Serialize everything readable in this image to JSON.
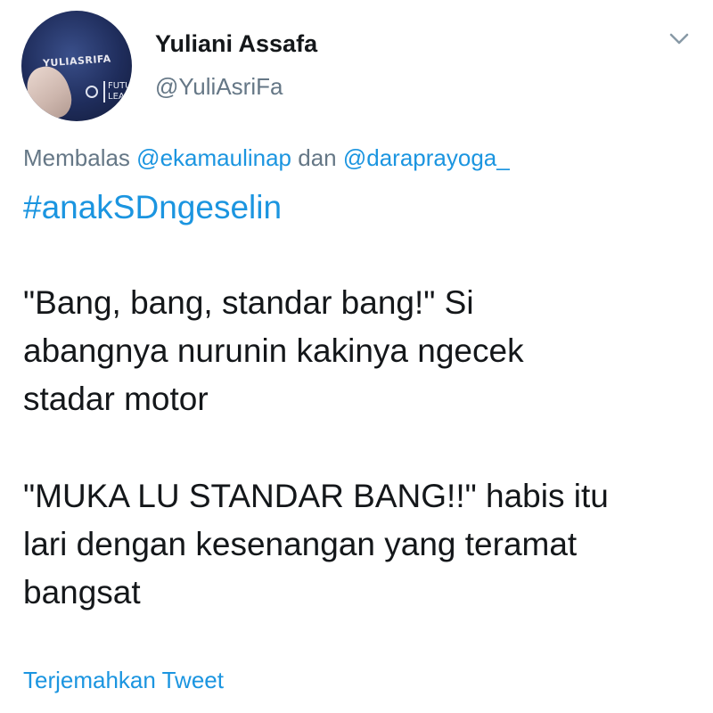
{
  "author": {
    "display_name": "Yuliani Assafa",
    "handle": "@YuliAsriFa",
    "avatar": {
      "badge_text": "YULIASRIFA",
      "patch_line1": "FUTURE",
      "patch_line2": "LEADER"
    }
  },
  "reply": {
    "prefix": "Membalas",
    "mention1": "@ekamaulinap",
    "joiner": "dan",
    "mention2": "@daraprayoga_"
  },
  "hashtag": "#anakSDngeselin",
  "body": {
    "para1": [
      "\"Bang, bang, standar bang!\" Si",
      "abangnya nurunin kakinya ngecek",
      "stadar motor"
    ],
    "para2": [
      "\"MUKA LU STANDAR BANG!!\" habis itu",
      "lari dengan kesenangan yang teramat",
      "bangsat"
    ]
  },
  "translate_link": "Terjemahkan Tweet",
  "icons": {
    "menu": "chevron-down-icon"
  },
  "colors": {
    "link": "#1b95e0",
    "secondary_text": "#657786",
    "primary_text": "#14171a",
    "background": "#ffffff"
  }
}
